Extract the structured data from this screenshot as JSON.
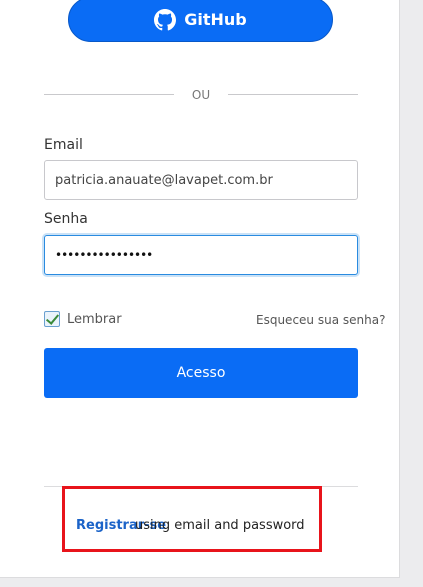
{
  "github_button": {
    "label": "GitHub",
    "icon": "github-icon"
  },
  "divider": {
    "label": "OU"
  },
  "email": {
    "label": "Email",
    "value": "patricia.anauate@lavapet.com.br"
  },
  "password": {
    "label": "Senha",
    "value": "••••••••••••••••"
  },
  "remember": {
    "label": "Lembrar",
    "checked": true
  },
  "forgot": {
    "label": "Esqueceu sua senha?"
  },
  "access_button": {
    "label": "Acesso"
  },
  "register": {
    "link_label": "Registrar-se",
    "suffix": "using email and password"
  },
  "colors": {
    "primary": "#0a6cf5",
    "annotation": "#e8141b"
  }
}
